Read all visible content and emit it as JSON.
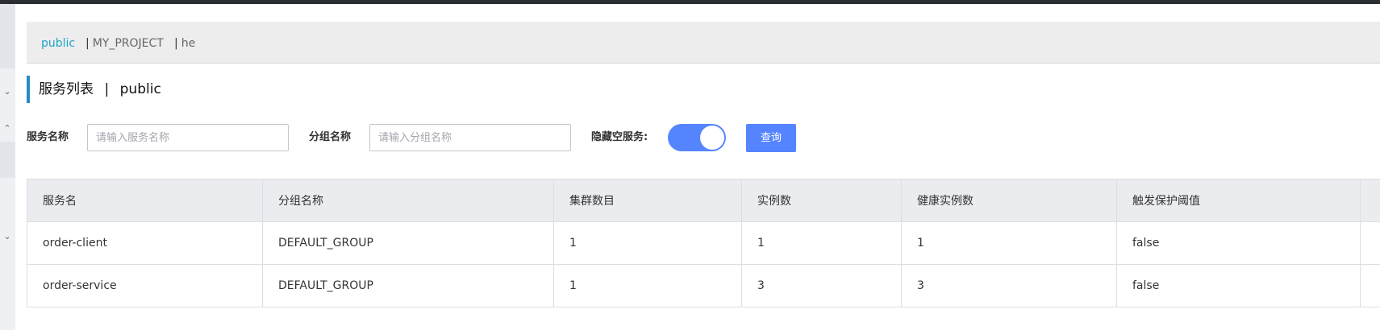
{
  "namespaces": [
    {
      "label": "public",
      "active": true
    },
    {
      "label": "MY_PROJECT",
      "active": false
    },
    {
      "label": "he",
      "active": false
    }
  ],
  "namespace_separator": "|",
  "page": {
    "title": "服务列表",
    "title_separator": "|",
    "namespace": "public"
  },
  "filters": {
    "service_name_label": "服务名称",
    "service_name_placeholder": "请输入服务名称",
    "service_name_value": "",
    "group_name_label": "分组名称",
    "group_name_placeholder": "请输入分组名称",
    "group_name_value": "",
    "hide_empty_label": "隐藏空服务:",
    "hide_empty_on": true,
    "query_label": "查询"
  },
  "table": {
    "columns": [
      "服务名",
      "分组名称",
      "集群数目",
      "实例数",
      "健康实例数",
      "触发保护阈值"
    ],
    "rows": [
      [
        "order-client",
        "DEFAULT_GROUP",
        "1",
        "1",
        "1",
        "false"
      ],
      [
        "order-service",
        "DEFAULT_GROUP",
        "1",
        "3",
        "3",
        "false"
      ]
    ]
  },
  "colors": {
    "accent": "#1ba6c8",
    "primary": "#5584ff",
    "title_bar": "#2a8cc4"
  }
}
